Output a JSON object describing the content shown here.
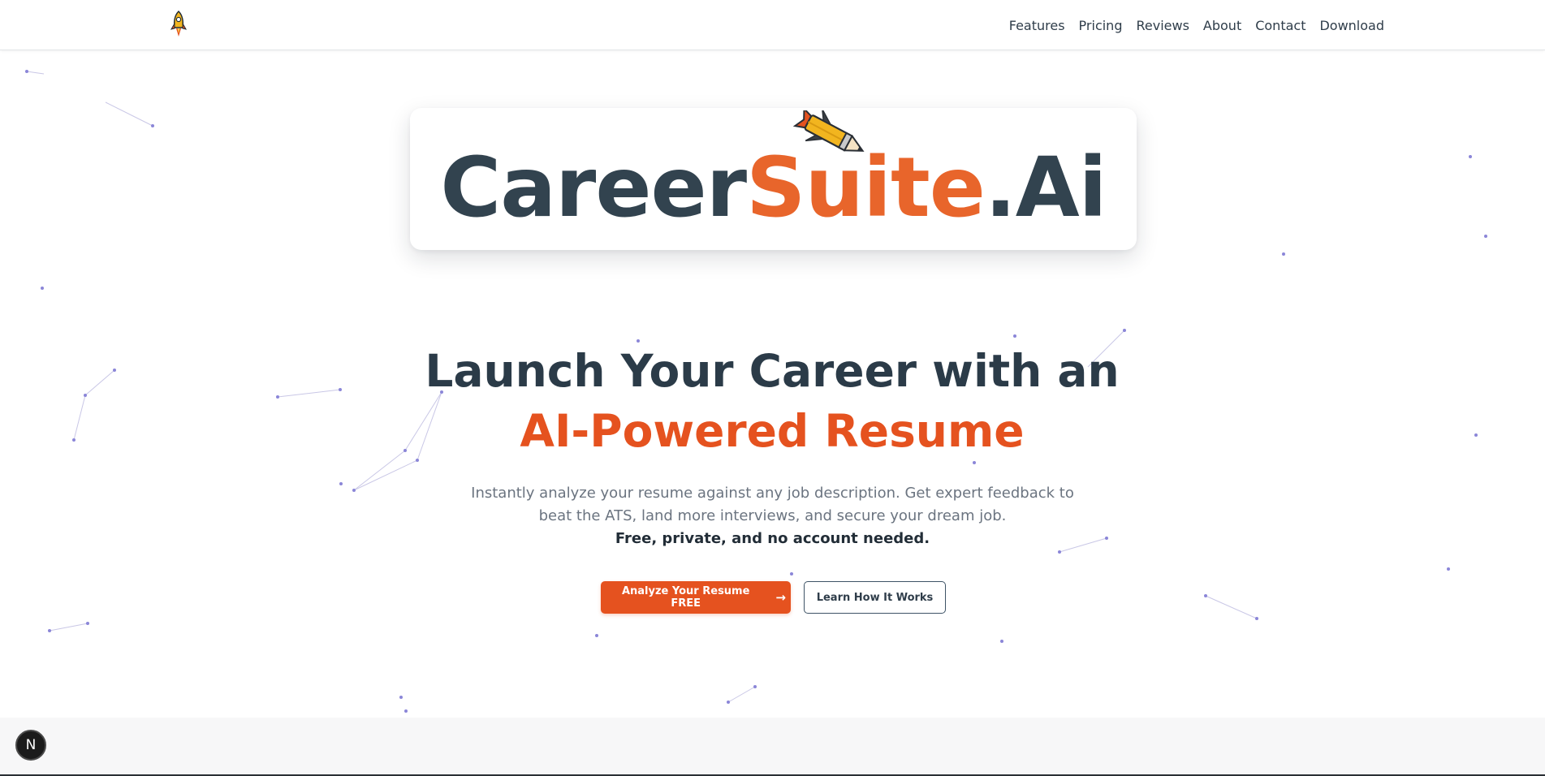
{
  "nav": {
    "logo_icon": "rocket-icon",
    "links": [
      "Features",
      "Pricing",
      "Reviews",
      "About",
      "Contact",
      "Download"
    ]
  },
  "brand": {
    "part1": "Career",
    "part2": "Suite",
    "part3": ".Ai",
    "icon": "rocket-pencil-icon"
  },
  "hero": {
    "headline_line1": "Launch Your Career with an",
    "headline_line2": "AI-Powered Resume",
    "description": "Instantly analyze your resume against any job description. Get expert feedback to beat the ATS, land more interviews, and secure your dream job.",
    "description_strong": "Free, private, and no account needed.",
    "primary_button": "Analyze Your Resume FREE",
    "primary_button_icon": "arrow-right-icon",
    "secondary_button": "Learn How It Works"
  },
  "badge": {
    "label": "N"
  },
  "colors": {
    "accent_orange": "#e5521f",
    "brand_orange": "#e8652b",
    "brand_dark": "#32434f",
    "network_dot": "#8b86d8"
  }
}
